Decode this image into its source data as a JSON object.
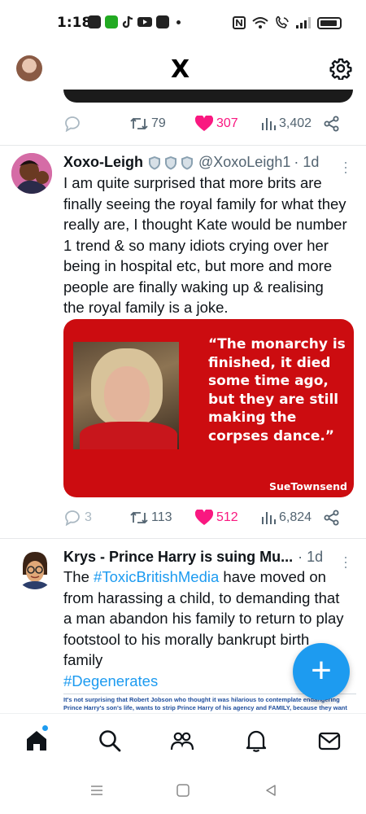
{
  "status_bar": {
    "time": "1:18",
    "icons": [
      "messenger-icon",
      "wechat-icon",
      "tiktok-icon",
      "youtube-icon",
      "app-icon",
      "dot-icon"
    ],
    "right_icons": [
      "nfc-icon",
      "wifi-icon",
      "wifi-call-icon",
      "signal-icon",
      "battery-icon"
    ]
  },
  "header": {
    "logo": "X"
  },
  "tweets": [
    {
      "stats": {
        "replies": "",
        "retweets": "79",
        "likes": "307",
        "views": "3,402"
      }
    },
    {
      "name": "Xoxo-Leigh",
      "handle": "@XoxoLeigh1",
      "time": "· 1d",
      "text": "I am quite surprised that more brits are finally seeing the royal family for what they really are, I thought Kate would be number 1 trend & so many idiots crying over her being in hospital etc, but more and more people are finally waking up & realising the royal family is a joke.",
      "media": {
        "quote": "“The monarchy is finished, it died some time ago, but they are still making the corpses dance.”",
        "author": "SueTownsend"
      },
      "stats": {
        "replies": "3",
        "retweets": "113",
        "likes": "512",
        "views": "6,824"
      }
    },
    {
      "name": "Krys - Prince Harry is suing Mu...",
      "time": "· 1d",
      "text_before": "The ",
      "hashtag1": "#ToxicBritishMedia",
      "text_after": " have moved on from harassing a child, to demanding that a man abandon his family to return to play footstool to his morally bankrupt birth family",
      "hashtag2": "#Degenerates",
      "snippet": "It's not surprising that Robert Jobson who thought it was hilarious to contemplate endangering Prince Harry's son's life, wants to strip Prince Harry of his agency and FAMILY, because they want the access"
    }
  ],
  "fab": {
    "label": "+"
  },
  "bottom_nav": [
    "home-icon",
    "search-icon",
    "communities-icon",
    "notifications-icon",
    "messages-icon"
  ],
  "colors": {
    "accent": "#1d9bf0",
    "like": "#f91880",
    "quote_bg": "#cc0c10"
  }
}
